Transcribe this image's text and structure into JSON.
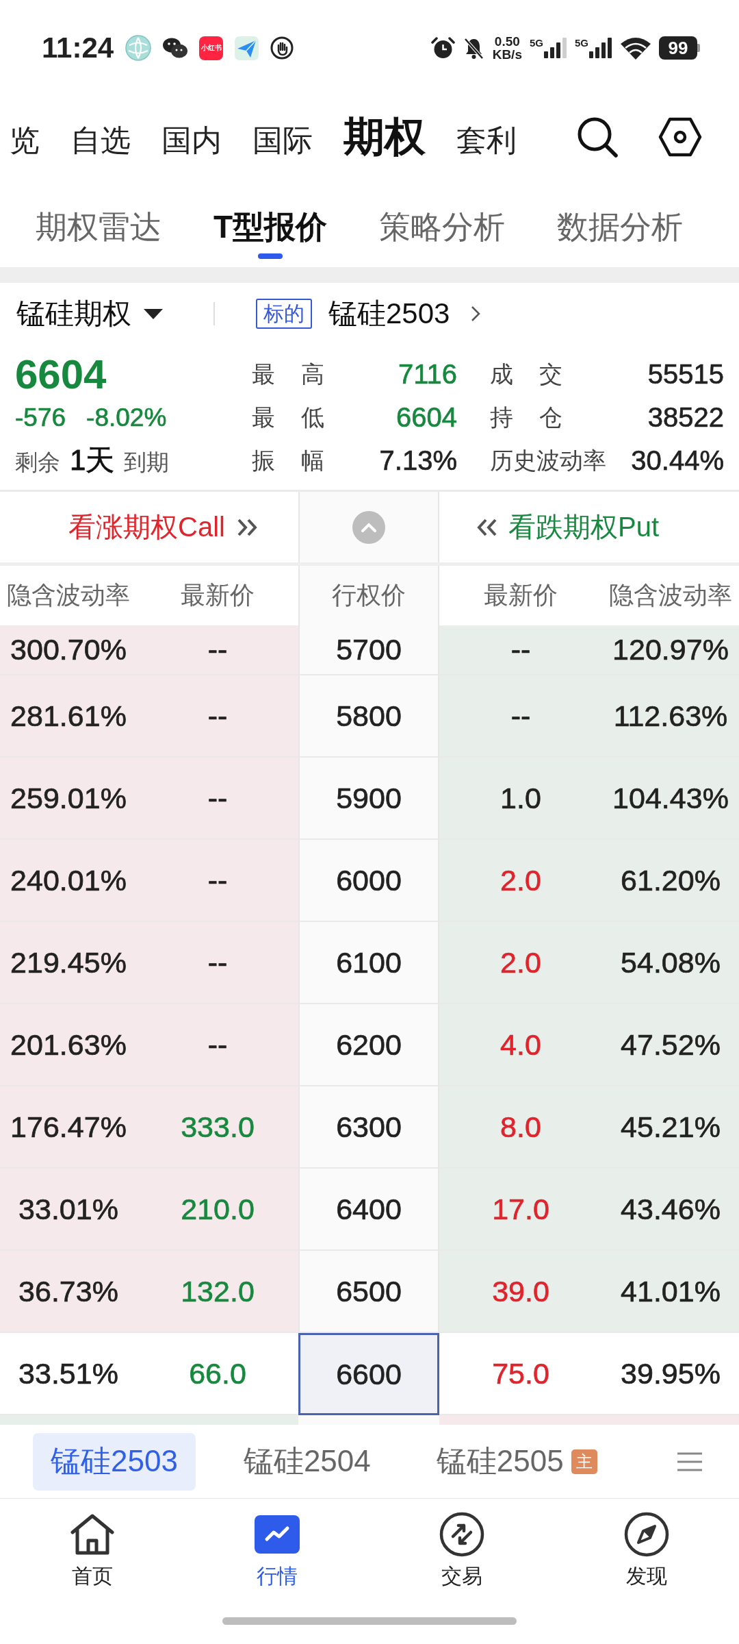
{
  "status_bar": {
    "time": "11:24",
    "app_logo_text": "小红书",
    "net_speed": "0.50",
    "net_unit": "KB/s",
    "signal_labels": [
      "5G",
      "5G"
    ],
    "battery": "99"
  },
  "top_nav": {
    "tabs": [
      {
        "label": "览",
        "selected": false
      },
      {
        "label": "自选",
        "selected": false
      },
      {
        "label": "国内",
        "selected": false
      },
      {
        "label": "国际",
        "selected": false
      },
      {
        "label": "期权",
        "selected": true
      },
      {
        "label": "套利",
        "selected": false
      }
    ]
  },
  "sub_tabs": [
    {
      "label": "期权雷达",
      "selected": false
    },
    {
      "label": "T型报价",
      "selected": true
    },
    {
      "label": "策略分析",
      "selected": false
    },
    {
      "label": "数据分析",
      "selected": false
    }
  ],
  "quote": {
    "product": "锰硅期权",
    "underlying_tag": "标的",
    "underlying": "锰硅2503",
    "color": "#17893f",
    "price": "6604",
    "change": "-576",
    "change_pct": "-8.02%",
    "expiry": {
      "prefix": "剩余",
      "days": "1天",
      "suffix": "到期"
    },
    "stats": [
      {
        "label": "最 高",
        "value": "7116",
        "color": "#17893f"
      },
      {
        "label": "成 交",
        "value": "55515",
        "color": "#222222"
      },
      {
        "label": "最 低",
        "value": "6604",
        "color": "#17893f"
      },
      {
        "label": "持 仓",
        "value": "38522",
        "color": "#222222"
      },
      {
        "label": "振 幅",
        "value": "7.13%",
        "color": "#222222"
      },
      {
        "label": "历史波动率",
        "value": "30.44%",
        "color": "#222222"
      }
    ]
  },
  "table": {
    "call_header": "看涨期权Call",
    "put_header": "看跌期权Put",
    "columns": [
      "隐含波动率",
      "最新价",
      "行权价",
      "最新价",
      "隐含波动率"
    ],
    "rows": [
      {
        "kind": "below",
        "strike": "5700",
        "call_iv": "300.70%",
        "call_last": {
          "text": "--",
          "color": "#222222"
        },
        "put_last": {
          "text": "--",
          "color": "#222222"
        },
        "put_iv": "120.97%"
      },
      {
        "kind": "below",
        "strike": "5800",
        "call_iv": "281.61%",
        "call_last": {
          "text": "--",
          "color": "#222222"
        },
        "put_last": {
          "text": "--",
          "color": "#222222"
        },
        "put_iv": "112.63%"
      },
      {
        "kind": "below",
        "strike": "5900",
        "call_iv": "259.01%",
        "call_last": {
          "text": "--",
          "color": "#222222"
        },
        "put_last": {
          "text": "1.0",
          "color": "#222222"
        },
        "put_iv": "104.43%"
      },
      {
        "kind": "below",
        "strike": "6000",
        "call_iv": "240.01%",
        "call_last": {
          "text": "--",
          "color": "#222222"
        },
        "put_last": {
          "text": "2.0",
          "color": "#e0242c"
        },
        "put_iv": "61.20%"
      },
      {
        "kind": "below",
        "strike": "6100",
        "call_iv": "219.45%",
        "call_last": {
          "text": "--",
          "color": "#222222"
        },
        "put_last": {
          "text": "2.0",
          "color": "#e0242c"
        },
        "put_iv": "54.08%"
      },
      {
        "kind": "below",
        "strike": "6200",
        "call_iv": "201.63%",
        "call_last": {
          "text": "--",
          "color": "#222222"
        },
        "put_last": {
          "text": "4.0",
          "color": "#e0242c"
        },
        "put_iv": "47.52%"
      },
      {
        "kind": "below",
        "strike": "6300",
        "call_iv": "176.47%",
        "call_last": {
          "text": "333.0",
          "color": "#17893f"
        },
        "put_last": {
          "text": "8.0",
          "color": "#e0242c"
        },
        "put_iv": "45.21%"
      },
      {
        "kind": "below",
        "strike": "6400",
        "call_iv": "33.01%",
        "call_last": {
          "text": "210.0",
          "color": "#17893f"
        },
        "put_last": {
          "text": "17.0",
          "color": "#e0242c"
        },
        "put_iv": "43.46%"
      },
      {
        "kind": "below",
        "strike": "6500",
        "call_iv": "36.73%",
        "call_last": {
          "text": "132.0",
          "color": "#17893f"
        },
        "put_last": {
          "text": "39.0",
          "color": "#e0242c"
        },
        "put_iv": "41.01%"
      },
      {
        "kind": "atm",
        "strike": "6600",
        "call_iv": "33.51%",
        "call_last": {
          "text": "66.0",
          "color": "#17893f"
        },
        "put_last": {
          "text": "75.0",
          "color": "#e0242c"
        },
        "put_iv": "39.95%"
      }
    ],
    "next_row": {
      "kind": "above"
    }
  },
  "contract_tabs": [
    {
      "label": "锰硅2503",
      "selected": true
    },
    {
      "label": "锰硅2504",
      "selected": false
    },
    {
      "label": "锰硅2505",
      "selected": false,
      "badge": "主"
    }
  ],
  "bottom_nav": [
    {
      "label": "首页",
      "selected": false
    },
    {
      "label": "行情",
      "selected": true
    },
    {
      "label": "交易",
      "selected": false
    },
    {
      "label": "发现",
      "selected": false
    }
  ]
}
